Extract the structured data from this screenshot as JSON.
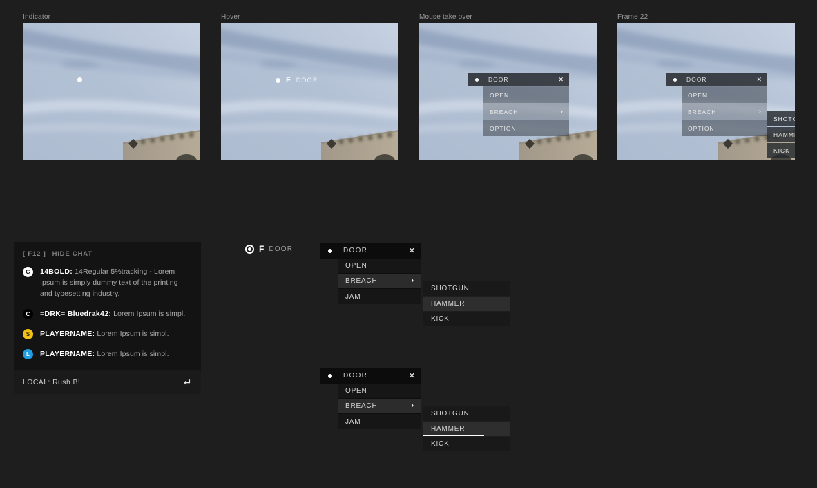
{
  "canvas": {
    "bg": "#1e1e1e"
  },
  "frames": [
    {
      "label": "Indicator"
    },
    {
      "label": "Hover"
    },
    {
      "label": "Mouse take over"
    },
    {
      "label": "Frame 22"
    }
  ],
  "hover_indicator": {
    "key": "F",
    "target": "DOOR"
  },
  "focus_indicator": {
    "key": "F",
    "target": "DOOR"
  },
  "game_menu": {
    "title": "DOOR",
    "close_icon": "✕",
    "submenu_arrow": "›",
    "items": [
      {
        "label": "OPEN"
      },
      {
        "label": "BREACH"
      },
      {
        "label": "OPTION"
      }
    ],
    "submenu": [
      {
        "label": "SHOTGUN"
      },
      {
        "label": "HAMMER"
      },
      {
        "label": "KICK"
      }
    ]
  },
  "spec_menu": {
    "title": "DOOR",
    "close_icon": "✕",
    "submenu_arrow": "›",
    "items": [
      {
        "label": "OPEN"
      },
      {
        "label": "BREACH"
      },
      {
        "label": "JAM"
      }
    ],
    "submenu": [
      {
        "label": "SHOTGUN"
      },
      {
        "label": "HAMMER"
      },
      {
        "label": "KICK"
      }
    ]
  },
  "chat": {
    "hotkey": "[ F12 ]",
    "toggle_label": "HIDE CHAT",
    "messages": [
      {
        "badge_letter": "G",
        "badge_bg": "#ffffff",
        "badge_fg": "#141414",
        "name": "14BOLD:",
        "text": "14Regular 5%tracking - Lorem Ipsum is simply dummy text of the printing and typesetting industry."
      },
      {
        "badge_letter": "C",
        "badge_bg": "#000000",
        "badge_fg": "#ffffff",
        "name": "=DRK= Bluedrak42:",
        "text": "Lorem Ipsum is simpl."
      },
      {
        "badge_letter": "S",
        "badge_bg": "#f2c115",
        "badge_fg": "#2a2208",
        "name": "PLAYERNAME:",
        "text": "Lorem Ipsum is simpl."
      },
      {
        "badge_letter": "L",
        "badge_bg": "#1f9de0",
        "badge_fg": "#ffffff",
        "name": "PLAYERNAME:",
        "text": "Lorem Ipsum is simpl."
      }
    ],
    "input": {
      "value": "LOCAL: Rush B!",
      "enter_icon": "↵"
    }
  }
}
